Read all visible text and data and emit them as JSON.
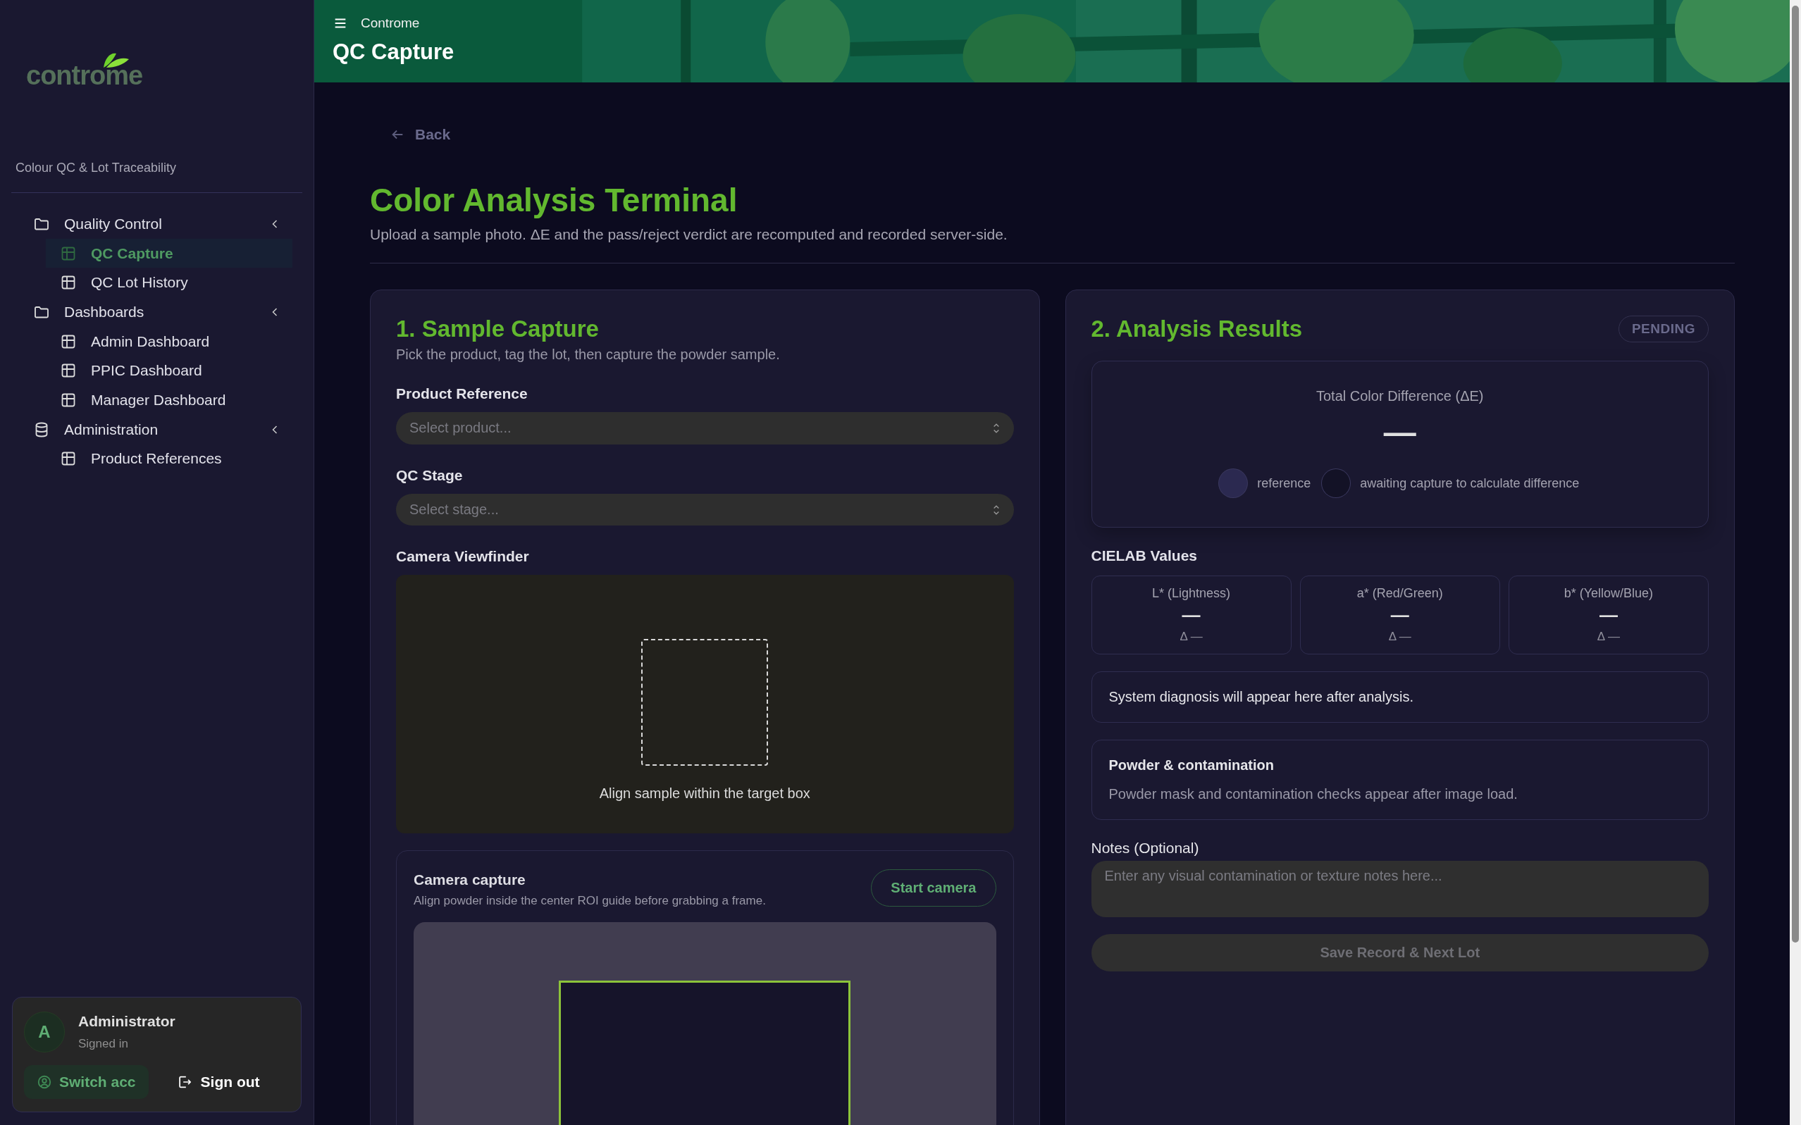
{
  "sidebar": {
    "logo": "controme",
    "tagline": "Colour QC & Lot Traceability",
    "nav": [
      {
        "label": "Quality Control",
        "kind": "folder",
        "children": [
          {
            "label": "QC Capture",
            "selected": true
          },
          {
            "label": "QC Lot History",
            "selected": false
          }
        ]
      },
      {
        "label": "Dashboards",
        "kind": "folder",
        "children": [
          {
            "label": "Admin Dashboard",
            "selected": false
          },
          {
            "label": "PPIC Dashboard",
            "selected": false
          },
          {
            "label": "Manager Dashboard",
            "selected": false
          }
        ]
      },
      {
        "label": "Administration",
        "kind": "database",
        "children": [
          {
            "label": "Product References",
            "selected": false
          }
        ]
      }
    ],
    "user": {
      "avatar": "A",
      "name": "Administrator",
      "status": "Signed in",
      "switch_button": "Switch acc",
      "sign_out": "Sign out"
    }
  },
  "header": {
    "breadcrumb": "Controme",
    "title": "QC Capture"
  },
  "back": "Back",
  "page": {
    "title": "Color Analysis Terminal",
    "subtitle": "Upload a sample photo. ΔE and the pass/reject verdict are recomputed and recorded server-side."
  },
  "capture_card": {
    "title": "1. Sample Capture",
    "subtitle": "Pick the product, tag the lot, then capture the powder sample.",
    "fields": [
      {
        "label": "Product Reference",
        "placeholder": "Select product..."
      },
      {
        "label": "QC Stage",
        "placeholder": "Select stage..."
      }
    ],
    "viewfinder": {
      "label": "Camera Viewfinder",
      "hint": "Align sample within the target box"
    },
    "camera": {
      "title": "Camera capture",
      "hint": "Align powder inside the center ROI guide before grabbing a frame.",
      "button": "Start camera"
    }
  },
  "results_card": {
    "title": "2. Analysis Results",
    "status": "PENDING",
    "delta_e": {
      "label": "Total Color Difference (ΔE)",
      "value": "—",
      "legend": [
        {
          "label": "reference",
          "color": "#2b2950"
        },
        {
          "label": "awaiting capture to calculate difference",
          "color": "#131226"
        }
      ]
    },
    "cielab_title": "CIELAB Values",
    "cielab": [
      {
        "label": "L* (Lightness)",
        "value": "—",
        "delta": "Δ —"
      },
      {
        "label": "a* (Red/Green)",
        "value": "—",
        "delta": "Δ —"
      },
      {
        "label": "b* (Yellow/Blue)",
        "value": "—",
        "delta": "Δ —"
      }
    ],
    "diagnosis": "System diagnosis will appear here after analysis.",
    "powder": {
      "title": "Powder & contamination",
      "text": "Powder mask and contamination checks appear after image load."
    },
    "notes": {
      "label": "Notes (Optional)",
      "placeholder": "Enter any visual contamination or texture notes here..."
    },
    "save_button": "Save Record & Next Lot"
  }
}
